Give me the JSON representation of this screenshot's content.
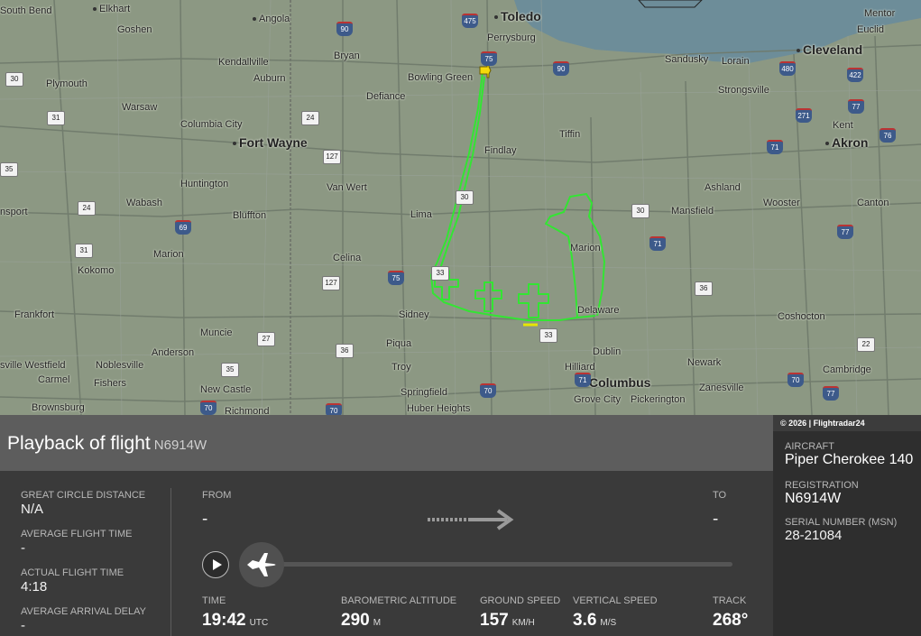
{
  "map": {
    "copyright": "© 2026 | Flightradar24",
    "cities": [
      {
        "name": "Toledo",
        "big": true
      },
      {
        "name": "Cleveland",
        "big": true
      },
      {
        "name": "Fort Wayne",
        "big": true
      },
      {
        "name": "Akron",
        "big": true
      },
      {
        "name": "Columbus",
        "big": true
      },
      {
        "name": "South Bend"
      },
      {
        "name": "Elkhart"
      },
      {
        "name": "Goshen"
      },
      {
        "name": "Angola"
      },
      {
        "name": "Bryan"
      },
      {
        "name": "Perrysburg"
      },
      {
        "name": "Bowling Green"
      },
      {
        "name": "Sandusky"
      },
      {
        "name": "Lorain"
      },
      {
        "name": "Mentor"
      },
      {
        "name": "Euclid"
      },
      {
        "name": "Kendallville"
      },
      {
        "name": "Auburn"
      },
      {
        "name": "Defiance"
      },
      {
        "name": "Plymouth"
      },
      {
        "name": "Warsaw"
      },
      {
        "name": "Columbia City"
      },
      {
        "name": "Strongsville"
      },
      {
        "name": "Tiffin"
      },
      {
        "name": "Kent"
      },
      {
        "name": "Findlay"
      },
      {
        "name": "Van Wert"
      },
      {
        "name": "Huntington"
      },
      {
        "name": "Wabash"
      },
      {
        "name": "Bluffton"
      },
      {
        "name": "Lima"
      },
      {
        "name": "Ashland"
      },
      {
        "name": "Mansfield"
      },
      {
        "name": "Wooster"
      },
      {
        "name": "Canton"
      },
      {
        "name": "nsport"
      },
      {
        "name": "Marion"
      },
      {
        "name": "Kokomo"
      },
      {
        "name": "Celina"
      },
      {
        "name": "Sidney"
      },
      {
        "name": "Delaware"
      },
      {
        "name": "Coshocton"
      },
      {
        "name": "Frankfort"
      },
      {
        "name": "Muncie"
      },
      {
        "name": "Anderson"
      },
      {
        "name": "Piqua"
      },
      {
        "name": "Dublin"
      },
      {
        "name": "Hilliard"
      },
      {
        "name": "Newark"
      },
      {
        "name": "Cambridge"
      },
      {
        "name": "sville Westfield"
      },
      {
        "name": "Noblesville"
      },
      {
        "name": "Troy"
      },
      {
        "name": "Carmel"
      },
      {
        "name": "Fishers"
      },
      {
        "name": "New Castle"
      },
      {
        "name": "Springfield"
      },
      {
        "name": "Grove City"
      },
      {
        "name": "Pickerington"
      },
      {
        "name": "Zanesville"
      },
      {
        "name": "Brownsburg"
      },
      {
        "name": "Richmond"
      },
      {
        "name": "Huber Heights"
      },
      {
        "name": "Marion"
      }
    ],
    "shields": [
      "475",
      "90",
      "90",
      "480",
      "422",
      "77",
      "271",
      "76",
      "75",
      "30",
      "31",
      "24",
      "127",
      "35",
      "69",
      "30",
      "71",
      "71",
      "30",
      "33",
      "127",
      "75",
      "31",
      "24",
      "36",
      "33",
      "77",
      "70",
      "71",
      "22",
      "36",
      "35",
      "27",
      "70",
      "70",
      "70",
      "77"
    ]
  },
  "flight": {
    "title": "Playback of flight",
    "registration": "N6914W"
  },
  "stats": {
    "great_circle_label": "GREAT CIRCLE DISTANCE",
    "great_circle_value": "N/A",
    "avg_flight_label": "AVERAGE FLIGHT TIME",
    "avg_flight_value": "-",
    "actual_flight_label": "ACTUAL FLIGHT TIME",
    "actual_flight_value": "4:18",
    "avg_delay_label": "AVERAGE ARRIVAL DELAY",
    "avg_delay_value": "-"
  },
  "route": {
    "from_label": "FROM",
    "from_value": "-",
    "to_label": "TO",
    "to_value": "-"
  },
  "readouts": {
    "time_label": "TIME",
    "time_value": "19:42",
    "time_unit": "UTC",
    "baro_label": "BAROMETRIC ALTITUDE",
    "baro_value": "290",
    "baro_unit": "M",
    "gs_label": "GROUND SPEED",
    "gs_value": "157",
    "gs_unit": "KM/H",
    "vs_label": "VERTICAL SPEED",
    "vs_value": "3.6",
    "vs_unit": "M/S",
    "track_label": "TRACK",
    "track_value": "268°"
  },
  "aircraft": {
    "aircraft_label": "AIRCRAFT",
    "aircraft_value": "Piper Cherokee 140",
    "registration_label": "REGISTRATION",
    "registration_value": "N6914W",
    "serial_label": "SERIAL NUMBER (MSN)",
    "serial_value": "28-21084"
  },
  "colors": {
    "flight_path": "#33e533",
    "lake": "#6d8d99"
  }
}
